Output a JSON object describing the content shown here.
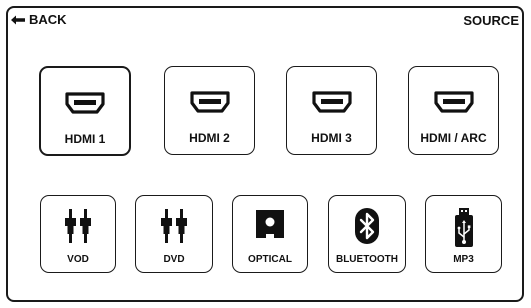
{
  "header": {
    "back_label": "BACK",
    "source_label": "SOURCE"
  },
  "sources_row1": [
    {
      "label": "HDMI 1",
      "icon": "hdmi-icon",
      "selected": true
    },
    {
      "label": "HDMI 2",
      "icon": "hdmi-icon",
      "selected": false
    },
    {
      "label": "HDMI 3",
      "icon": "hdmi-icon",
      "selected": false
    },
    {
      "label": "HDMI / ARC",
      "icon": "hdmi-icon",
      "selected": false
    }
  ],
  "sources_row2": [
    {
      "label": "VOD",
      "icon": "rca-plug-icon"
    },
    {
      "label": "DVD",
      "icon": "rca-plug-icon"
    },
    {
      "label": "OPTICAL",
      "icon": "optical-icon"
    },
    {
      "label": "BLUETOOTH",
      "icon": "bluetooth-icon"
    },
    {
      "label": "MP3",
      "icon": "usb-icon"
    }
  ]
}
